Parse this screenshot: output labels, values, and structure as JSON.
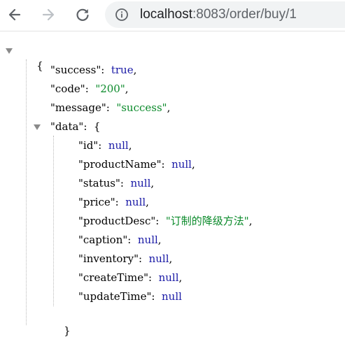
{
  "browser": {
    "url_host": "localhost",
    "url_path": ":8083/order/buy/1"
  },
  "json": {
    "open_brace": "{",
    "close_brace": "}",
    "data_open": "{",
    "data_close": "}",
    "success_key": "\"success\":",
    "success_value": "true",
    "code_key": "\"code\":",
    "code_value": "\"200\"",
    "message_key": "\"message\":",
    "message_value": "\"success\"",
    "data_key": "\"data\":",
    "fields": [
      {
        "key": "\"id\":",
        "value": "null",
        "comma": ","
      },
      {
        "key": "\"productName\":",
        "value": "null",
        "comma": ","
      },
      {
        "key": "\"status\":",
        "value": "null",
        "comma": ","
      },
      {
        "key": "\"price\":",
        "value": "null",
        "comma": ","
      },
      {
        "key": "\"productDesc\":",
        "value": "\"订制的降级方法\"",
        "comma": ","
      },
      {
        "key": "\"caption\":",
        "value": "null",
        "comma": ","
      },
      {
        "key": "\"inventory\":",
        "value": "null",
        "comma": ","
      },
      {
        "key": "\"createTime\":",
        "value": "null",
        "comma": ","
      },
      {
        "key": "\"updateTime\":",
        "value": "null",
        "comma": ""
      }
    ]
  },
  "colors": {
    "keyword": "#1a1aa6",
    "string": "#0a8a2a",
    "text": "#000000"
  }
}
